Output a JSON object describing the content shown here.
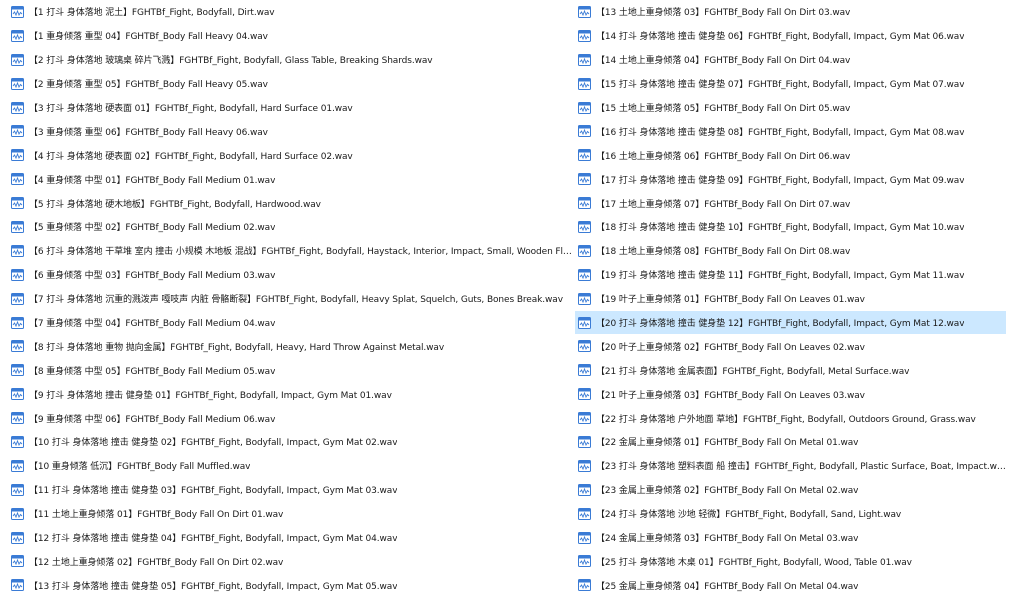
{
  "file_icon": "audio-file-icon",
  "colors": {
    "selection": "#cce8ff",
    "icon_blue": "#3a7bd5",
    "text": "#1a1a1a"
  },
  "left_column": [
    {
      "name": "【1 打斗 身体落地 泥土】FGHTBf_Fight, Bodyfall, Dirt.wav"
    },
    {
      "name": "【1 重身倾落 重型 04】FGHTBf_Body Fall Heavy 04.wav"
    },
    {
      "name": "【2 打斗 身体落地 玻璃桌 碎片飞溅】FGHTBf_Fight, Bodyfall, Glass Table, Breaking Shards.wav"
    },
    {
      "name": "【2 重身倾落 重型 05】FGHTBf_Body Fall Heavy 05.wav"
    },
    {
      "name": "【3 打斗 身体落地 硬表面 01】FGHTBf_Fight, Bodyfall, Hard Surface 01.wav"
    },
    {
      "name": "【3 重身倾落 重型 06】FGHTBf_Body Fall Heavy 06.wav"
    },
    {
      "name": "【4 打斗 身体落地 硬表面 02】FGHTBf_Fight, Bodyfall, Hard Surface 02.wav"
    },
    {
      "name": "【4 重身倾落 中型 01】FGHTBf_Body Fall Medium 01.wav"
    },
    {
      "name": "【5 打斗 身体落地 硬木地板】FGHTBf_Fight, Bodyfall, Hardwood.wav"
    },
    {
      "name": "【5 重身倾落 中型 02】FGHTBf_Body Fall Medium 02.wav"
    },
    {
      "name": "【6 打斗 身体落地 干草堆 室内 撞击 小规模 木地板 混战】FGHTBf_Fight, Bodyfall, Haystack, Interior, Impact, Small, Wooden Floor,..."
    },
    {
      "name": "【6 重身倾落 中型 03】FGHTBf_Body Fall Medium 03.wav"
    },
    {
      "name": "【7 打斗 身体落地 沉重的溅泼声 嘎吱声 内脏 骨骼断裂】FGHTBf_Fight, Bodyfall, Heavy Splat, Squelch, Guts, Bones Break.wav"
    },
    {
      "name": "【7 重身倾落 中型 04】FGHTBf_Body Fall Medium 04.wav"
    },
    {
      "name": "【8 打斗 身体落地 重物 抛向金属】FGHTBf_Fight, Bodyfall, Heavy, Hard Throw Against Metal.wav"
    },
    {
      "name": "【8 重身倾落 中型 05】FGHTBf_Body Fall Medium 05.wav"
    },
    {
      "name": "【9 打斗 身体落地 撞击 健身垫 01】FGHTBf_Fight, Bodyfall, Impact, Gym Mat 01.wav"
    },
    {
      "name": "【9 重身倾落 中型 06】FGHTBf_Body Fall Medium 06.wav"
    },
    {
      "name": "【10 打斗 身体落地 撞击 健身垫 02】FGHTBf_Fight, Bodyfall, Impact, Gym Mat 02.wav"
    },
    {
      "name": "【10 重身倾落 低沉】FGHTBf_Body Fall Muffled.wav"
    },
    {
      "name": "【11 打斗 身体落地 撞击 健身垫 03】FGHTBf_Fight, Bodyfall, Impact, Gym Mat 03.wav"
    },
    {
      "name": "【11 土地上重身倾落 01】FGHTBf_Body Fall On Dirt 01.wav"
    },
    {
      "name": "【12 打斗 身体落地 撞击 健身垫 04】FGHTBf_Fight, Bodyfall, Impact, Gym Mat 04.wav"
    },
    {
      "name": "【12 土地上重身倾落 02】FGHTBf_Body Fall On Dirt 02.wav"
    },
    {
      "name": "【13 打斗 身体落地 撞击 健身垫 05】FGHTBf_Fight, Bodyfall, Impact, Gym Mat 05.wav"
    }
  ],
  "right_column": [
    {
      "name": "【13 土地上重身倾落 03】FGHTBf_Body Fall On Dirt 03.wav"
    },
    {
      "name": "【14 打斗 身体落地 撞击 健身垫 06】FGHTBf_Fight, Bodyfall, Impact, Gym Mat 06.wav"
    },
    {
      "name": "【14 土地上重身倾落 04】FGHTBf_Body Fall On Dirt 04.wav"
    },
    {
      "name": "【15 打斗 身体落地 撞击 健身垫 07】FGHTBf_Fight, Bodyfall, Impact, Gym Mat 07.wav"
    },
    {
      "name": "【15 土地上重身倾落 05】FGHTBf_Body Fall On Dirt 05.wav"
    },
    {
      "name": "【16 打斗 身体落地 撞击 健身垫 08】FGHTBf_Fight, Bodyfall, Impact, Gym Mat 08.wav"
    },
    {
      "name": "【16 土地上重身倾落 06】FGHTBf_Body Fall On Dirt 06.wav"
    },
    {
      "name": "【17 打斗 身体落地 撞击 健身垫 09】FGHTBf_Fight, Bodyfall, Impact, Gym Mat 09.wav"
    },
    {
      "name": "【17 土地上重身倾落 07】FGHTBf_Body Fall On Dirt 07.wav"
    },
    {
      "name": "【18 打斗 身体落地 撞击 健身垫 10】FGHTBf_Fight, Bodyfall, Impact, Gym Mat 10.wav"
    },
    {
      "name": "【18 土地上重身倾落 08】FGHTBf_Body Fall On Dirt 08.wav"
    },
    {
      "name": "【19 打斗 身体落地 撞击 健身垫 11】FGHTBf_Fight, Bodyfall, Impact, Gym Mat 11.wav"
    },
    {
      "name": "【19 叶子上重身倾落 01】FGHTBf_Body Fall On Leaves 01.wav"
    },
    {
      "name": "【20 打斗 身体落地 撞击 健身垫 12】FGHTBf_Fight, Bodyfall, Impact, Gym Mat 12.wav",
      "selected": true
    },
    {
      "name": "【20 叶子上重身倾落 02】FGHTBf_Body Fall On Leaves 02.wav"
    },
    {
      "name": "【21 打斗 身体落地 金属表面】FGHTBf_Fight, Bodyfall, Metal Surface.wav"
    },
    {
      "name": "【21 叶子上重身倾落 03】FGHTBf_Body Fall On Leaves 03.wav"
    },
    {
      "name": "【22 打斗 身体落地 户外地面 草地】FGHTBf_Fight, Bodyfall, Outdoors Ground, Grass.wav"
    },
    {
      "name": "【22 金属上重身倾落 01】FGHTBf_Body Fall On Metal 01.wav"
    },
    {
      "name": "【23 打斗 身体落地 塑料表面 船 撞击】FGHTBf_Fight, Bodyfall, Plastic Surface, Boat, Impact.wav"
    },
    {
      "name": "【23 金属上重身倾落 02】FGHTBf_Body Fall On Metal 02.wav"
    },
    {
      "name": "【24 打斗 身体落地 沙地 轻微】FGHTBf_Fight, Bodyfall, Sand, Light.wav"
    },
    {
      "name": "【24 金属上重身倾落 03】FGHTBf_Body Fall On Metal 03.wav"
    },
    {
      "name": "【25 打斗 身体落地 木桌 01】FGHTBf_Fight, Bodyfall, Wood, Table 01.wav"
    },
    {
      "name": "【25 金属上重身倾落 04】FGHTBf_Body Fall On Metal 04.wav"
    }
  ]
}
